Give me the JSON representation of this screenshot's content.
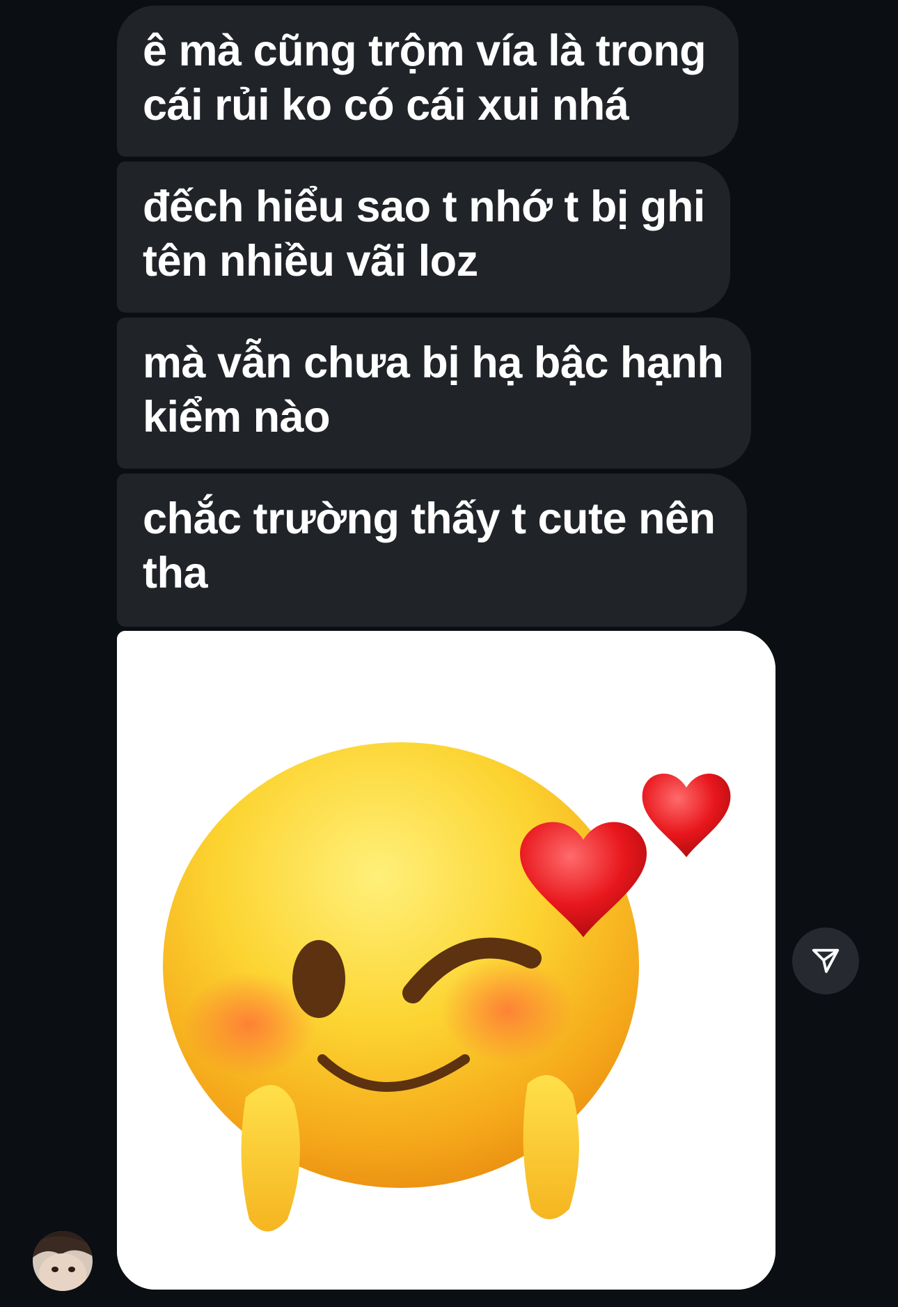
{
  "messages": [
    {
      "text": "ê mà cũng trộm vía là trong cái rủi ko có cái xui nhá"
    },
    {
      "text": "đếch hiểu sao t nhớ t bị ghi tên nhiều vãi loz"
    },
    {
      "text": "mà vẫn chưa bị hạ bậc hạnh kiểm nào"
    },
    {
      "text": "chắc trường thấy t cute nên tha"
    }
  ],
  "image_message": {
    "content": "winking-smiley-with-hearts-sticker"
  },
  "share_button": {
    "icon": "paper-plane-icon"
  },
  "avatar": {
    "icon": "contact-avatar"
  },
  "colors": {
    "background": "#0b0e12",
    "bubble": "#202328",
    "text": "#ffffff"
  }
}
